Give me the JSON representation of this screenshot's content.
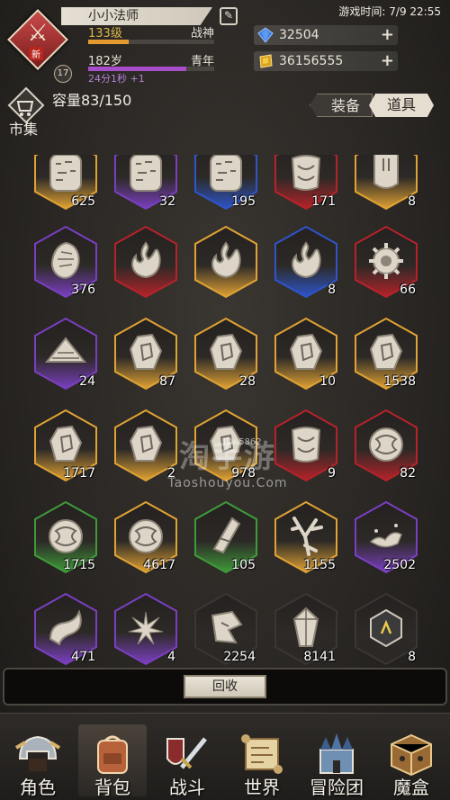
{
  "header": {
    "avatar_glyph": "⚔",
    "avatar_badge": "新",
    "avatar_level": "17",
    "player_name": "小小法师",
    "level": "133级",
    "rank": "战神",
    "age": "182岁",
    "season": "青年",
    "timer": "24分1秒 +1",
    "game_time": "游戏时间: 7/9 22:55",
    "diamonds": "32504",
    "gold": "36156555"
  },
  "inventory": {
    "market_label": "市集",
    "capacity": "容量83/150",
    "tabs": [
      "装备",
      "道具"
    ],
    "active_tab": "道具"
  },
  "items": [
    {
      "count": "625",
      "rarity": "gold",
      "art": "slab"
    },
    {
      "count": "32",
      "rarity": "purple",
      "art": "slab"
    },
    {
      "count": "195",
      "rarity": "blue",
      "art": "slab"
    },
    {
      "count": "171",
      "rarity": "red",
      "art": "scroll"
    },
    {
      "count": "8",
      "rarity": "gold",
      "art": "tablet"
    },
    {
      "count": "376",
      "rarity": "purple",
      "art": "egg"
    },
    {
      "count": "",
      "rarity": "red",
      "art": "flame"
    },
    {
      "count": "",
      "rarity": "gold",
      "art": "flame"
    },
    {
      "count": "8",
      "rarity": "blue",
      "art": "flame"
    },
    {
      "count": "66",
      "rarity": "red",
      "art": "flower"
    },
    {
      "count": "24",
      "rarity": "purple",
      "art": "pyramid"
    },
    {
      "count": "87",
      "rarity": "gold",
      "art": "crystal"
    },
    {
      "count": "28",
      "rarity": "gold",
      "art": "crystal"
    },
    {
      "count": "10",
      "rarity": "gold",
      "art": "crystal"
    },
    {
      "count": "1538",
      "rarity": "gold",
      "art": "crystal"
    },
    {
      "count": "1717",
      "rarity": "gold",
      "art": "crystal"
    },
    {
      "count": "2",
      "rarity": "gold",
      "art": "crystal"
    },
    {
      "count": "978",
      "rarity": "gold",
      "art": "crystal"
    },
    {
      "count": "9",
      "rarity": "red",
      "art": "scroll"
    },
    {
      "count": "82",
      "rarity": "red",
      "art": "coin"
    },
    {
      "count": "1715",
      "rarity": "green",
      "art": "coin"
    },
    {
      "count": "4617",
      "rarity": "gold",
      "art": "coin"
    },
    {
      "count": "105",
      "rarity": "green",
      "art": "shard"
    },
    {
      "count": "1155",
      "rarity": "gold",
      "art": "branch"
    },
    {
      "count": "2502",
      "rarity": "purple",
      "art": "dust"
    },
    {
      "count": "471",
      "rarity": "purple",
      "art": "horn"
    },
    {
      "count": "4",
      "rarity": "purple",
      "art": "burst"
    },
    {
      "count": "2254",
      "rarity": "none",
      "art": "slab2"
    },
    {
      "count": "8141",
      "rarity": "none",
      "art": "crystal2"
    },
    {
      "count": "8",
      "rarity": "none",
      "art": "box"
    }
  ],
  "watermark": {
    "main": "淘手游",
    "sub": "Taoshouyou.Com",
    "id": "ID: 5862"
  },
  "recycle_label": "回收",
  "nav": [
    {
      "label": "角色",
      "icon": "helmet-icon"
    },
    {
      "label": "背包",
      "icon": "backpack-icon"
    },
    {
      "label": "战斗",
      "icon": "sword-shield-icon"
    },
    {
      "label": "世界",
      "icon": "scroll-map-icon"
    },
    {
      "label": "冒险团",
      "icon": "castle-icon"
    },
    {
      "label": "魔盒",
      "icon": "magic-box-icon"
    }
  ],
  "nav_active": "背包",
  "colors": {
    "gold": "#e0a234",
    "purple": "#7a3fc0",
    "blue": "#2e55c8",
    "red": "#b5232a",
    "green": "#3f9a3a",
    "none": "#2b2826"
  }
}
